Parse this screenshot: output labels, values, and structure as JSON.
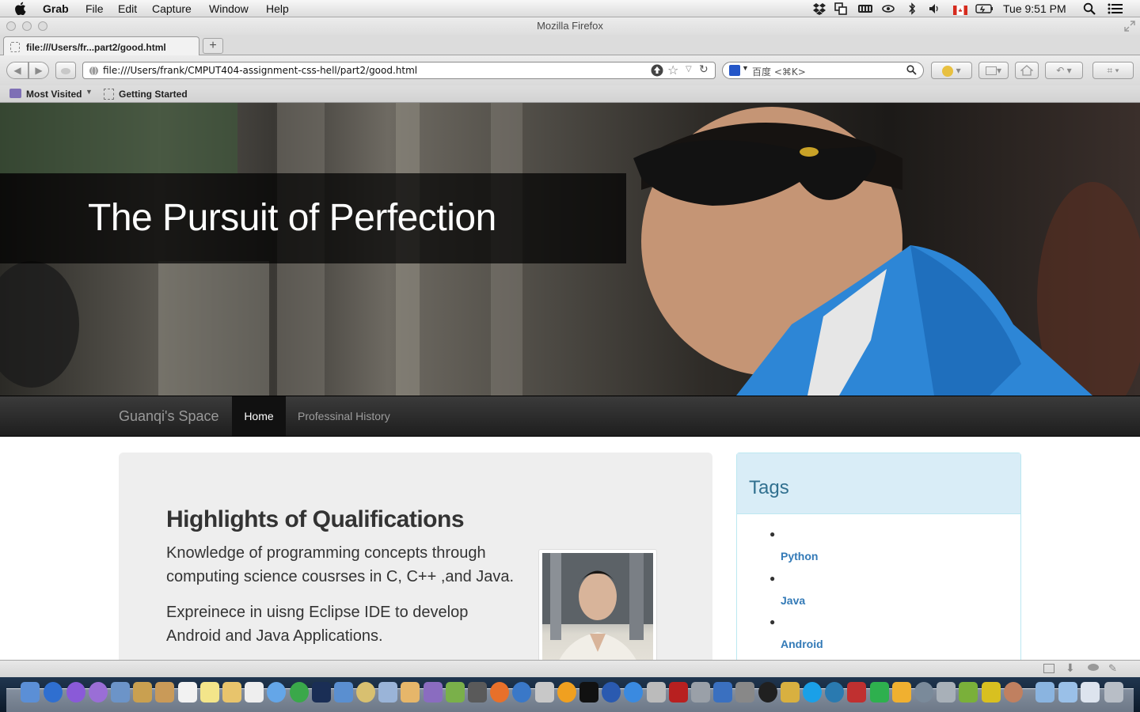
{
  "menubar": {
    "app_name": "Grab",
    "menus": [
      "File",
      "Edit",
      "Capture",
      "Window",
      "Help"
    ],
    "clock": "Tue 9:51 PM"
  },
  "window": {
    "title": "Mozilla Firefox"
  },
  "tabs": [
    {
      "label": "file:///Users/fr...part2/good.html",
      "active": true
    }
  ],
  "new_tab_label": "+",
  "address_bar": {
    "url": "file:///Users/frank/CMPUT404-assignment-css-hell/part2/good.html"
  },
  "search_bar": {
    "placeholder": "百度 <⌘K>"
  },
  "bookmarks": [
    {
      "label": "Most Visited",
      "icon": "folder-icon"
    },
    {
      "label": "Getting Started",
      "icon": "page-icon"
    }
  ],
  "page": {
    "hero_title": "The Pursuit of Perfection",
    "nav": {
      "brand": "Guanqi's Space",
      "items": [
        "Home",
        "Professinal History"
      ],
      "active": "Home"
    },
    "main": {
      "heading": "Highlights of Qualifications",
      "paragraphs": [
        "Knowledge of programming concepts through computing science cousrses in C, C++ ,and Java.",
        "Expreinece in uisng Eclipse IDE to develop Android and Java Applications."
      ]
    },
    "tags": {
      "title": "Tags",
      "items": [
        "Python",
        "Java",
        "Android"
      ]
    }
  },
  "colors": {
    "nav_bg": "#222222",
    "tags_header_bg": "#d9edf7",
    "tags_title": "#31708f",
    "link": "#337ab7",
    "card_bg": "#eeeeee"
  }
}
